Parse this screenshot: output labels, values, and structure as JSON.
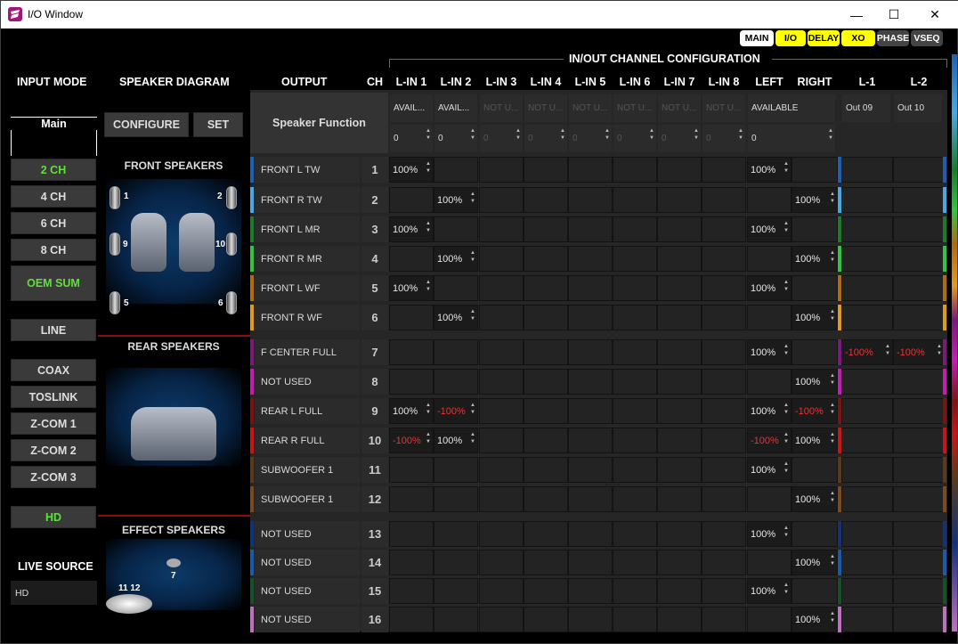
{
  "window": {
    "title": "I/O Window",
    "minimize": "—",
    "maximize": "☐",
    "close": "✕"
  },
  "top_buttons": [
    {
      "label": "MAIN",
      "bg": "#ffffff",
      "fg": "#000000",
      "w": 38
    },
    {
      "label": "I/O",
      "bg": "#ffff00",
      "fg": "#000000",
      "w": 34
    },
    {
      "label": "DELAY",
      "bg": "#ffff00",
      "fg": "#000000",
      "w": 36
    },
    {
      "label": "XO",
      "bg": "#ffff00",
      "fg": "#000000",
      "w": 38
    },
    {
      "label": "PHASE",
      "bg": "#444444",
      "fg": "#ffffff",
      "w": 36
    },
    {
      "label": "VSEQ",
      "bg": "#444444",
      "fg": "#ffffff",
      "w": 36
    }
  ],
  "headers": {
    "input_mode": "INPUT MODE",
    "speaker_diagram": "SPEAKER DIAGRAM",
    "output": "OUTPUT",
    "ch": "CH",
    "in_out_config": "IN/OUT CHANNEL CONFIGURATION",
    "speaker_function": "Speaker Function"
  },
  "input_cols": [
    "L-IN 1",
    "L-IN 2",
    "L-IN 3",
    "L-IN 4",
    "L-IN 5",
    "L-IN 6",
    "L-IN 7",
    "L-IN 8",
    "LEFT",
    "RIGHT",
    "L-1",
    "L-2"
  ],
  "config_row": {
    "status": [
      "AVAIL...",
      "AVAIL...",
      "NOT U...",
      "NOT U...",
      "NOT U...",
      "NOT U...",
      "NOT U...",
      "NOT U...",
      "AVAILABLE",
      "",
      "Out 09",
      "Out 10"
    ],
    "values": [
      "0",
      "0",
      "0",
      "0",
      "0",
      "0",
      "0",
      "0",
      "0"
    ]
  },
  "input_mode": {
    "tab": "Main",
    "buttons": [
      "2 CH",
      "4 CH",
      "6 CH",
      "8 CH",
      "OEM SUM"
    ],
    "line": "LINE",
    "digital": [
      "COAX",
      "TOSLINK",
      "Z-COM 1",
      "Z-COM 2",
      "Z-COM 3"
    ],
    "hd": "HD",
    "live_source_label": "LIVE SOURCE",
    "live_source_value": "HD"
  },
  "speaker_diagram": {
    "configure": "CONFIGURE",
    "set": "SET",
    "front": "FRONT SPEAKERS",
    "rear": "REAR SPEAKERS",
    "effect": "EFFECT SPEAKERS",
    "front_labels": [
      "1",
      "2",
      "9",
      "10",
      "5",
      "6"
    ],
    "effect_labels": [
      "7",
      "11 12"
    ]
  },
  "rows": [
    {
      "ch": "1",
      "fn": "FRONT L TW",
      "color": "#1f5fb0",
      "vals": {
        "0": "100%",
        "8": "100%"
      }
    },
    {
      "ch": "2",
      "fn": "FRONT R TW",
      "color": "#4aa8e0",
      "vals": {
        "1": "100%",
        "9": "100%"
      }
    },
    {
      "ch": "3",
      "fn": "FRONT L MR",
      "color": "#1c7a2c",
      "vals": {
        "0": "100%",
        "8": "100%"
      }
    },
    {
      "ch": "4",
      "fn": "FRONT R MR",
      "color": "#36c244",
      "vals": {
        "1": "100%",
        "9": "100%"
      }
    },
    {
      "ch": "5",
      "fn": "FRONT L WF",
      "color": "#b06a10",
      "vals": {
        "0": "100%",
        "8": "100%"
      }
    },
    {
      "ch": "6",
      "fn": "FRONT R WF",
      "color": "#e09a20",
      "vals": {
        "1": "100%",
        "9": "100%"
      }
    },
    {
      "ch": "7",
      "fn": "F CENTER FULL",
      "color": "#7a1a7a",
      "vals": {
        "8": "100%",
        "10": "-100%",
        "11": "-100%"
      }
    },
    {
      "ch": "8",
      "fn": "NOT USED",
      "color": "#c020b0",
      "vals": {
        "9": "100%"
      }
    },
    {
      "ch": "9",
      "fn": "REAR L FULL",
      "color": "#7a1414",
      "vals": {
        "0": "100%",
        "1": "-100%",
        "8": "100%",
        "9": "-100%"
      }
    },
    {
      "ch": "10",
      "fn": "REAR R FULL",
      "color": "#c41818",
      "vals": {
        "0": "-100%",
        "1": "100%",
        "8": "-100%",
        "9": "100%"
      }
    },
    {
      "ch": "11",
      "fn": "SUBWOOFER 1",
      "color": "#5a3a1a",
      "vals": {
        "8": "100%"
      }
    },
    {
      "ch": "12",
      "fn": "SUBWOOFER 1",
      "color": "#7a4a20",
      "vals": {
        "9": "100%"
      }
    },
    {
      "ch": "13",
      "fn": "NOT USED",
      "color": "#12327a",
      "vals": {
        "8": "100%"
      }
    },
    {
      "ch": "14",
      "fn": "NOT USED",
      "color": "#1a5aa8",
      "vals": {
        "9": "100%"
      }
    },
    {
      "ch": "15",
      "fn": "NOT USED",
      "color": "#15522a",
      "vals": {
        "8": "100%"
      }
    },
    {
      "ch": "16",
      "fn": "NOT USED",
      "color": "#c070c0",
      "vals": {
        "9": "100%"
      }
    }
  ]
}
